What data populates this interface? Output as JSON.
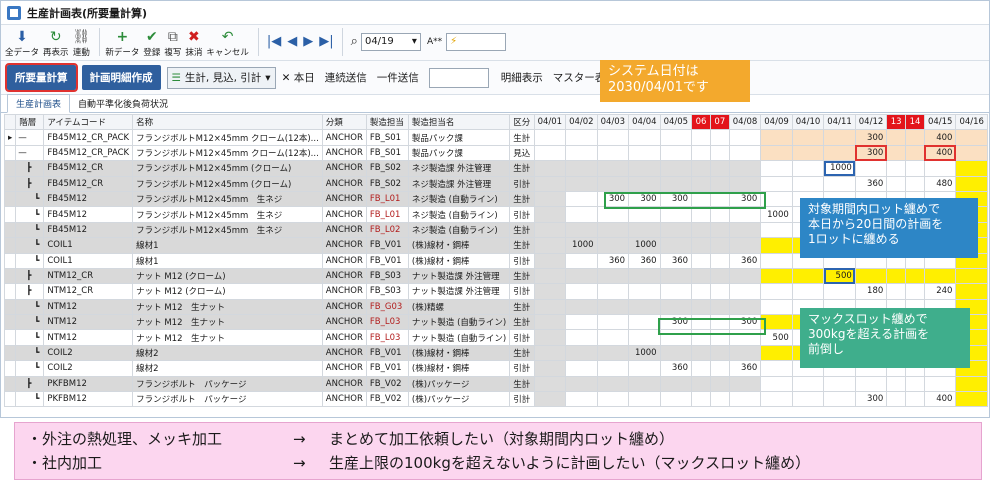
{
  "window": {
    "title": "生産計画表(所要量計算)"
  },
  "ribbon": {
    "buttons": [
      {
        "icon": "⬇",
        "label": "全データ"
      },
      {
        "icon": "↻",
        "label": "再表示"
      },
      {
        "icon": "⛓",
        "label": "連動"
      },
      {
        "icon": "+",
        "label": "新データ"
      },
      {
        "icon": "✔",
        "label": "登録"
      },
      {
        "icon": "⧉",
        "label": "複写"
      },
      {
        "icon": "✖",
        "label": "抹消"
      },
      {
        "icon": "↶",
        "label": "キャンセル"
      }
    ],
    "nav": [
      "|◀",
      "◀",
      "▶",
      "▶|"
    ],
    "date_value": "04/19",
    "font_label": "A**"
  },
  "toolbar": {
    "calc_button": "所要量計算",
    "detail_button": "計画明細作成",
    "combo_value": "生計, 見込, 引計",
    "today": "本日",
    "continuous_send": "連続送信",
    "bulk_send": "一件送信",
    "detail_view": "明細表示",
    "master_view": "マスター表示"
  },
  "tabs": [
    "生産計画表",
    "自動平準化後負荷状況"
  ],
  "grid": {
    "headers": [
      "階層",
      "アイテムコード",
      "名称",
      "分類",
      "製造担当",
      "製造担当名",
      "区分"
    ],
    "dates": [
      "04/01",
      "04/02",
      "04/03",
      "04/04",
      "04/05",
      "06",
      "07",
      "04/08",
      "04/09",
      "04/10",
      "04/11",
      "04/12",
      "13",
      "14",
      "04/15",
      "04/16"
    ],
    "rows": [
      {
        "lvl": "—",
        "code": "FB45M12_CR_PACK",
        "name": "フランジボルトM12×45mm クローム(12本)...",
        "cls": "ANCHOR",
        "mfg": "FB_S01",
        "mfgname": "製品パック課",
        "kbn": "生計",
        "cells": {
          "11": "300",
          "14": "400"
        }
      },
      {
        "lvl": "—",
        "code": "FB45M12_CR_PACK",
        "name": "フランジボルトM12×45mm クローム(12本)...",
        "cls": "ANCHOR",
        "mfg": "FB_S01",
        "mfgname": "製品パック課",
        "kbn": "見込",
        "cells": {
          "11": "300",
          "14": "400"
        }
      },
      {
        "lvl": "┣",
        "code": "FB45M12_CR",
        "name": "フランジボルトM12×45mm (クローム)",
        "cls": "ANCHOR",
        "mfg": "FB_S02",
        "mfgname": "ネジ製造課 外注管理",
        "kbn": "生計",
        "cells": {
          "10": "1000"
        }
      },
      {
        "lvl": "┣",
        "code": "FB45M12_CR",
        "name": "フランジボルトM12×45mm (クローム)",
        "cls": "ANCHOR",
        "mfg": "FB_S02",
        "mfgname": "ネジ製造課 外注管理",
        "kbn": "引計",
        "cells": {
          "11": "360",
          "14": "480"
        }
      },
      {
        "lvl": "┗",
        "code": "FB45M12",
        "name": "フランジボルトM12×45mm　生ネジ",
        "cls": "ANCHOR",
        "mfg": "FB_L01",
        "mfgname": "ネジ製造 (自動ライン)",
        "kbn": "生計",
        "cells": {
          "2": "300",
          "3": "300",
          "4": "300",
          "7": "300"
        }
      },
      {
        "lvl": "┗",
        "code": "FB45M12",
        "name": "フランジボルトM12×45mm　生ネジ",
        "cls": "ANCHOR",
        "mfg": "FB_L01",
        "mfgname": "ネジ製造 (自動ライン)",
        "kbn": "引計",
        "cells": {
          "8": "1000"
        }
      },
      {
        "lvl": "┗",
        "code": "FB45M12",
        "name": "フランジボルトM12×45mm　生ネジ",
        "cls": "ANCHOR",
        "mfg": "FB_L02",
        "mfgname": "ネジ製造 (自動ライン)",
        "kbn": "生計",
        "cells": {}
      },
      {
        "lvl": "┗",
        "code": "COIL1",
        "name": "線材1",
        "cls": "ANCHOR",
        "mfg": "FB_V01",
        "mfgname": "(株)線材・鋼棒",
        "kbn": "生計",
        "cells": {
          "1": "1000",
          "3": "1000"
        }
      },
      {
        "lvl": "┗",
        "code": "COIL1",
        "name": "線材1",
        "cls": "ANCHOR",
        "mfg": "FB_V01",
        "mfgname": "(株)線材・鋼棒",
        "kbn": "引計",
        "cells": {
          "2": "360",
          "3": "360",
          "4": "360",
          "7": "360"
        }
      },
      {
        "lvl": "┣",
        "code": "NTM12_CR",
        "name": "ナット M12 (クローム)",
        "cls": "ANCHOR",
        "mfg": "FB_S03",
        "mfgname": "ナット製造課 外注管理",
        "kbn": "生計",
        "cells": {
          "10": "500"
        }
      },
      {
        "lvl": "┣",
        "code": "NTM12_CR",
        "name": "ナット M12 (クローム)",
        "cls": "ANCHOR",
        "mfg": "FB_S03",
        "mfgname": "ナット製造課 外注管理",
        "kbn": "引計",
        "cells": {
          "11": "180",
          "14": "240"
        }
      },
      {
        "lvl": "┗",
        "code": "NTM12",
        "name": "ナット M12　生ナット",
        "cls": "ANCHOR",
        "mfg": "FB_G03",
        "mfgname": "(株)精螺",
        "kbn": "生計",
        "cells": {}
      },
      {
        "lvl": "┗",
        "code": "NTM12",
        "name": "ナット M12　生ナット",
        "cls": "ANCHOR",
        "mfg": "FB_L03",
        "mfgname": "ナット製造 (自動ライン)",
        "kbn": "生計",
        "cells": {
          "4": "300",
          "7": "300"
        }
      },
      {
        "lvl": "┗",
        "code": "NTM12",
        "name": "ナット M12　生ナット",
        "cls": "ANCHOR",
        "mfg": "FB_L03",
        "mfgname": "ナット製造 (自動ライン)",
        "kbn": "引計",
        "cells": {
          "8": "500"
        }
      },
      {
        "lvl": "┗",
        "code": "COIL2",
        "name": "線材2",
        "cls": "ANCHOR",
        "mfg": "FB_V01",
        "mfgname": "(株)線材・鋼棒",
        "kbn": "生計",
        "cells": {
          "3": "1000"
        }
      },
      {
        "lvl": "┗",
        "code": "COIL2",
        "name": "線材2",
        "cls": "ANCHOR",
        "mfg": "FB_V01",
        "mfgname": "(株)線材・鋼棒",
        "kbn": "引計",
        "cells": {
          "4": "360",
          "7": "360"
        }
      },
      {
        "lvl": "┣",
        "code": "PKFBM12",
        "name": "フランジボルト　パッケージ",
        "cls": "ANCHOR",
        "mfg": "FB_V02",
        "mfgname": "(株)パッケージ",
        "kbn": "生計",
        "cells": {}
      },
      {
        "lvl": "┗",
        "code": "PKFBM12",
        "name": "フランジボルト　パッケージ",
        "cls": "ANCHOR",
        "mfg": "FB_V02",
        "mfgname": "(株)パッケージ",
        "kbn": "引計",
        "cells": {
          "11": "300",
          "14": "400"
        }
      }
    ]
  },
  "callouts": {
    "date": [
      "システム日付は",
      "2030/04/01です"
    ],
    "lot": [
      "対象期間内ロット纏めで",
      "本日から20日間の計画を",
      "1ロットに纏める"
    ],
    "max": [
      "マックスロット纏めで",
      "300kgを超える計画を",
      "前倒し"
    ]
  },
  "notes": [
    {
      "a": "・外注の熱処理、メッキ加工",
      "b": "→",
      "c": "まとめて加工依頼したい（対象期間内ロット纏め）"
    },
    {
      "a": "・社内加工",
      "b": "→",
      "c": "生産上限の100kgを超えないように計画したい（マックスロット纏め）"
    }
  ]
}
